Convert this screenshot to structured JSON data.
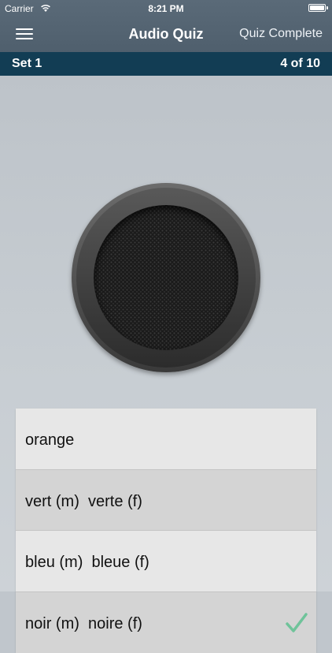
{
  "status_bar": {
    "carrier": "Carrier",
    "time": "8:21 PM"
  },
  "nav": {
    "title": "Audio Quiz",
    "right_button": "Quiz Complete",
    "menu_icon": "hamburger-menu-icon"
  },
  "set_bar": {
    "set_label": "Set 1",
    "progress": "4 of 10"
  },
  "speaker": {
    "icon": "speaker-icon"
  },
  "answers": [
    {
      "text": "orange"
    },
    {
      "text": "vert (m)  verte (f)"
    },
    {
      "text": "bleu (m)  bleue (f)"
    },
    {
      "text": "noir (m)  noire (f)",
      "icon": "checkmark-icon"
    }
  ],
  "colors": {
    "nav_bar": "#55636f",
    "set_bar": "#123d54",
    "background": "#c3c9ce",
    "check": "#6fc39a"
  }
}
